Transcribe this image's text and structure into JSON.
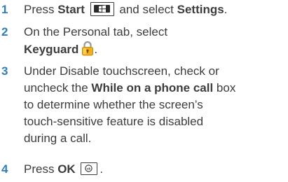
{
  "steps": [
    {
      "number": "1",
      "parts": {
        "t1": "Press ",
        "b1": "Start",
        "t2": " and select ",
        "b2": "Settings",
        "t3": "."
      }
    },
    {
      "number": "2",
      "parts": {
        "t1": "On the Personal tab, select",
        "b1": "Keyguard",
        "t2": "."
      }
    },
    {
      "number": "3",
      "parts": {
        "t1": "Under Disable touchscreen, check or",
        "t2": "uncheck the ",
        "b1": "While on a phone call",
        "t3": " box",
        "t4": "to determine whether the screen’s",
        "t5": "touch-sensitive feature is disabled",
        "t6": "during a call."
      }
    },
    {
      "number": "4",
      "parts": {
        "t1": "Press ",
        "b1": "OK",
        "t2": "."
      }
    }
  ],
  "icons": {
    "start_key": "windows-start-key-icon",
    "keyguard": "padlock-icon",
    "ok_key": "ok-key-icon"
  },
  "colors": {
    "step_number": "#2f7fb5",
    "text": "#3c3c3c",
    "lock_body": "#f2b01e"
  }
}
